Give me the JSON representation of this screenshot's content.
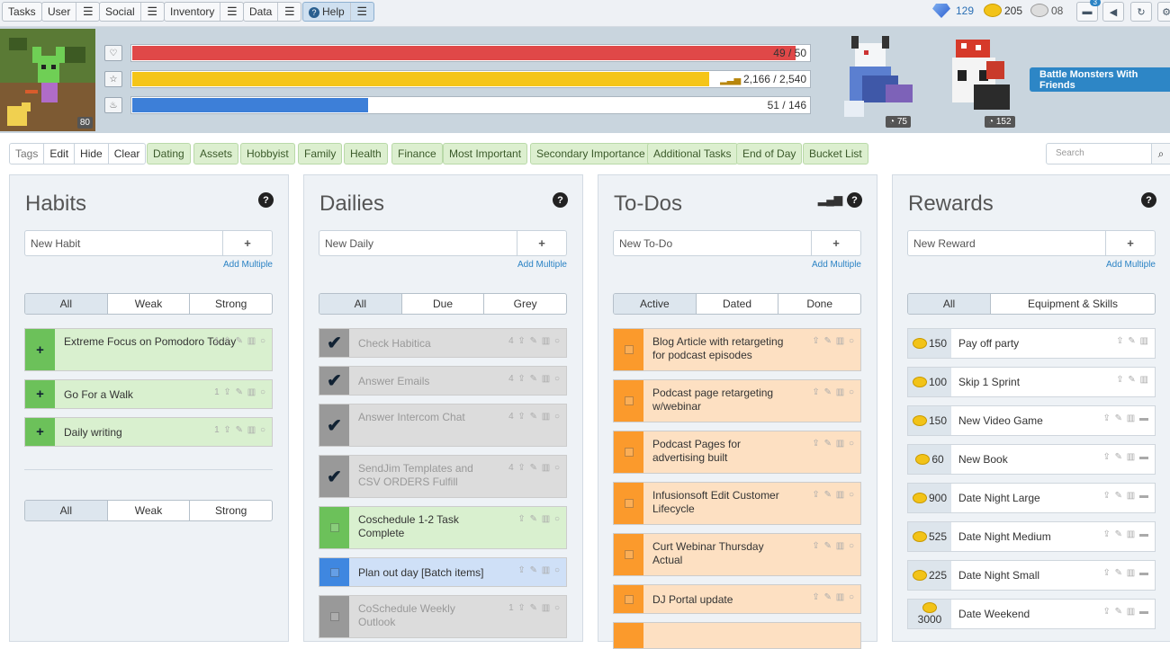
{
  "nav": {
    "tasks": "Tasks",
    "user": "User",
    "social": "Social",
    "inventory": "Inventory",
    "data": "Data",
    "help": "Help",
    "gems": "129",
    "gold": "205",
    "silver": "08",
    "messages_badge": "3"
  },
  "stats": {
    "health": "49 / 50",
    "experience": "2,166 / 2,540",
    "mana": "51 / 146",
    "health_pct": 0.98,
    "exp_pct": 0.853,
    "mana_pct": 0.349,
    "level": "80",
    "pet1_level": "75",
    "pet2_level": "152",
    "battle": "Battle Monsters With Friends"
  },
  "tags": {
    "tags": "Tags",
    "edit": "Edit",
    "hide": "Hide",
    "clear": "Clear",
    "items": [
      "Dating",
      "Assets",
      "Hobbyist",
      "Family",
      "Health",
      "Finance",
      "Most Important",
      "Secondary Importance",
      "Additional Tasks",
      "End of Day",
      "Bucket List"
    ],
    "search_placeholder": "Search"
  },
  "habits": {
    "title": "Habits",
    "new": "New Habit",
    "add_multiple": "Add Multiple",
    "tabs": [
      "All",
      "Weak",
      "Strong"
    ],
    "items": [
      "Extreme Focus on Pomodoro Today",
      "Go For a Walk",
      "Daily writing"
    ],
    "counts": [
      "1",
      "1",
      "1"
    ],
    "bottom_tabs": [
      "All",
      "Weak",
      "Strong"
    ]
  },
  "dailies": {
    "title": "Dailies",
    "new": "New Daily",
    "add_multiple": "Add Multiple",
    "tabs": [
      "All",
      "Due",
      "Grey"
    ],
    "items": [
      "Check Habitica",
      "Answer Emails",
      "Answer Intercom Chat",
      "SendJim Templates and CSV ORDERS Fulfill",
      "Coschedule 1-2 Task Complete",
      "Plan out day [Batch items]",
      "CoSchedule Weekly Outlook"
    ],
    "counts": [
      "4",
      "4",
      "4",
      "4",
      "",
      "",
      "1"
    ]
  },
  "todos": {
    "title": "To-Dos",
    "new": "New To-Do",
    "add_multiple": "Add Multiple",
    "tabs": [
      "Active",
      "Dated",
      "Done"
    ],
    "items": [
      "Blog Article with retargeting for podcast episodes",
      "Podcast page retargeting w/webinar",
      "Podcast Pages for advertising built",
      "Infusionsoft Edit Customer Lifecycle",
      "Curt Webinar Thursday Actual",
      "DJ Portal update"
    ]
  },
  "rewards": {
    "title": "Rewards",
    "new": "New Reward",
    "add_multiple": "Add Multiple",
    "tabs": [
      "All",
      "Equipment & Skills"
    ],
    "items": [
      {
        "price": "150",
        "name": "Pay off party"
      },
      {
        "price": "100",
        "name": "Skip 1 Sprint"
      },
      {
        "price": "150",
        "name": "New Video Game"
      },
      {
        "price": "60",
        "name": "New Book"
      },
      {
        "price": "900",
        "name": "Date Night Large"
      },
      {
        "price": "525",
        "name": "Date Night Medium"
      },
      {
        "price": "225",
        "name": "Date Night Small"
      },
      {
        "price": "3000",
        "name": "Date Weekend"
      }
    ]
  }
}
